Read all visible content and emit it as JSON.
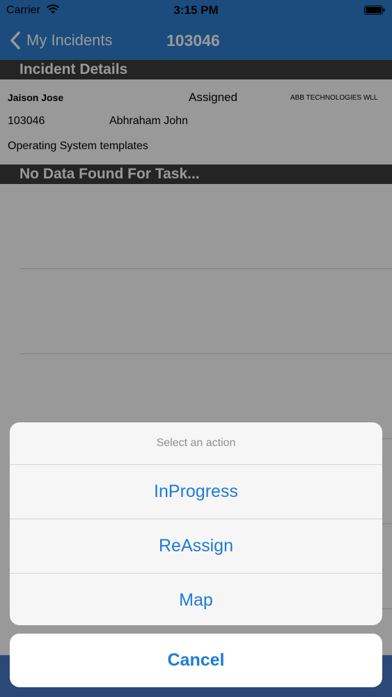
{
  "status_bar": {
    "carrier": "Carrier",
    "time": "3:15 PM"
  },
  "nav": {
    "back_label": "My Incidents",
    "title": "103046"
  },
  "sections": {
    "incident_details": "Incident Details",
    "tasks": "No Data Found For Task..."
  },
  "incident": {
    "reporter": "Jaison Jose",
    "status": "Assigned",
    "company": "ABB TECHNOLOGIES WLL",
    "id": "103046",
    "assignee": "Abhraham John",
    "description": "Operating System templates"
  },
  "action_sheet": {
    "title": "Select an action",
    "actions": [
      "InProgress",
      "ReAssign",
      "Map"
    ],
    "cancel": "Cancel"
  },
  "colors": {
    "nav_blue": "#2f7fd0",
    "action_blue": "#1e7bd6",
    "header_dark": "#3d3d3d"
  }
}
